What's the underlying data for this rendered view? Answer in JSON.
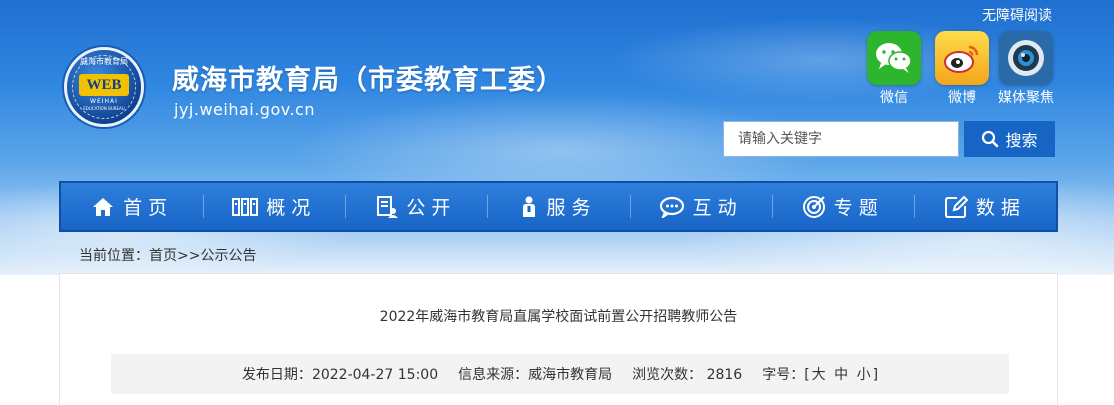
{
  "header": {
    "logo": {
      "top_text": "威海市教育局",
      "mark": "WEB",
      "sub1": "WEIHAI",
      "sub2": "EDUCATION BUREAU"
    },
    "site_title": "威海市教育局（市委教育工委）",
    "domain": "jyj.weihai.gov.cn",
    "accessibility_link": "无障碍阅读",
    "social": [
      {
        "label": "微信",
        "icon": "wechat-icon"
      },
      {
        "label": "微博",
        "icon": "weibo-icon"
      },
      {
        "label": "媒体聚焦",
        "icon": "camera-icon"
      }
    ],
    "search": {
      "placeholder": "请输入关键字",
      "button_label": "搜索"
    }
  },
  "nav": [
    {
      "label": "首页",
      "icon": "home-icon"
    },
    {
      "label": "概况",
      "icon": "overview-icon"
    },
    {
      "label": "公开",
      "icon": "disclosure-icon"
    },
    {
      "label": "服务",
      "icon": "service-icon"
    },
    {
      "label": "互动",
      "icon": "chat-icon"
    },
    {
      "label": "专题",
      "icon": "target-icon"
    },
    {
      "label": "数据",
      "icon": "edit-data-icon"
    }
  ],
  "breadcrumb": {
    "prefix": "当前位置：",
    "home": "首页",
    "separator": ">>",
    "current": "公示公告"
  },
  "article": {
    "title": "2022年威海市教育局直属学校面试前置公开招聘教师公告",
    "meta": {
      "date_label": "发布日期：",
      "date": "2022-04-27 15:00",
      "source_label": "信息来源：",
      "source": "威海市教育局",
      "views_label": "浏览次数：",
      "views": "2816",
      "fontsize_label": "字号：",
      "fontsize_open": "[",
      "fontsize_large": "大",
      "fontsize_medium": "中",
      "fontsize_small": "小",
      "fontsize_close": "]"
    }
  },
  "colors": {
    "nav_blue": "#1765c7",
    "search_blue": "#1665c5",
    "header_sky": "#2f86e0"
  }
}
